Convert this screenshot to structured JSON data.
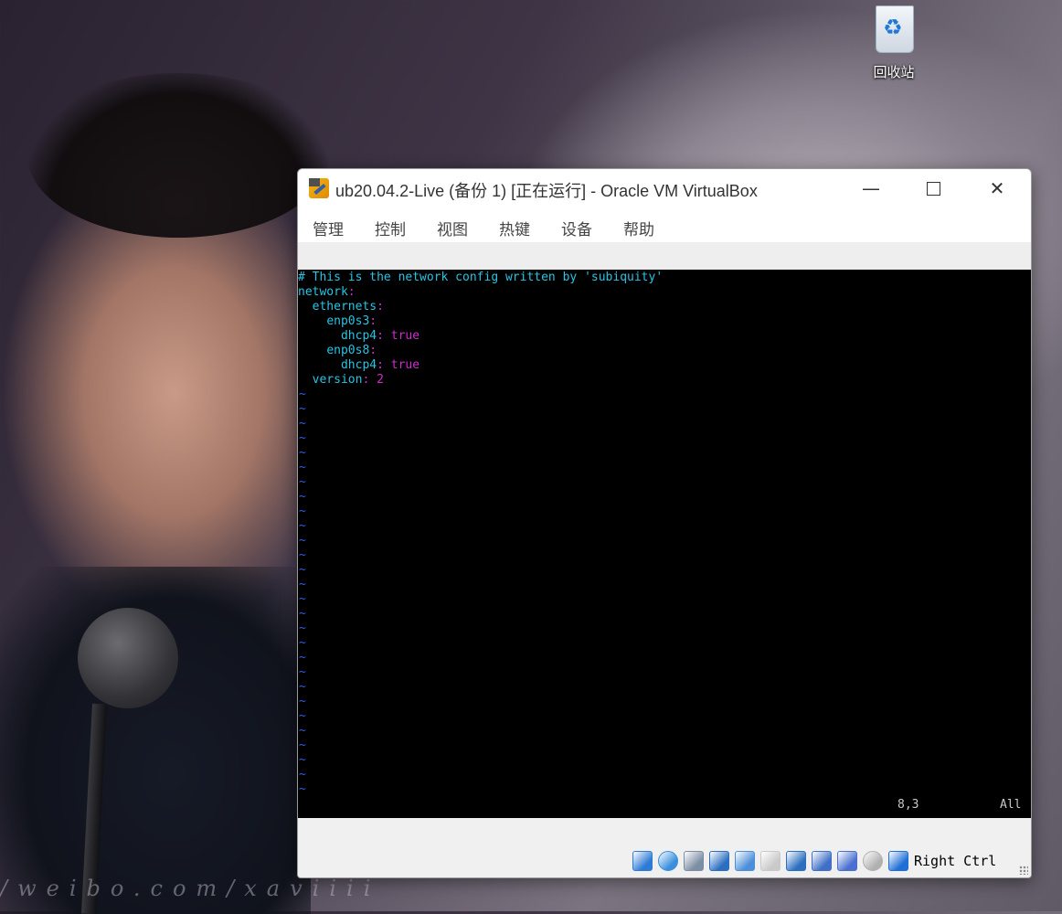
{
  "desktop": {
    "recycle_bin_label": "回收站",
    "watermark": "/weibo.com/xaviiii"
  },
  "window": {
    "title": "ub20.04.2-Live (备份 1) [正在运行] - Oracle VM VirtualBox",
    "min_symbol": "—",
    "close_symbol": "✕"
  },
  "menu": {
    "items": [
      "管理",
      "控制",
      "视图",
      "热键",
      "设备",
      "帮助"
    ]
  },
  "vm": {
    "lines": [
      {
        "indent": "",
        "key": "# This is the network config written by 'subiquity'",
        "colon": "",
        "value": "",
        "kind": "comment"
      },
      {
        "indent": "",
        "key": "network",
        "colon": ":",
        "value": ""
      },
      {
        "indent": "  ",
        "key": "ethernets",
        "colon": ":",
        "value": ""
      },
      {
        "indent": "    ",
        "key": "enp0s3",
        "colon": ":",
        "value": ""
      },
      {
        "indent": "      ",
        "key": "dhcp4",
        "colon": ": ",
        "value": "true"
      },
      {
        "indent": "    ",
        "key": "enp0s8",
        "colon": ":",
        "value": ""
      },
      {
        "indent": "      ",
        "key": "dhcp4",
        "colon": ": ",
        "value": "true"
      },
      {
        "indent": "  ",
        "key": "version",
        "colon": ": ",
        "value": "2"
      }
    ],
    "tilde": "~",
    "tilde_count": 28,
    "cursor_position": "8,3",
    "scroll_indicator": "All"
  },
  "statusbar": {
    "icons": [
      "hard-disk-icon",
      "optical-drive-icon",
      "audio-icon",
      "network-icon",
      "usb-icon",
      "shared-folders-icon",
      "display-icon",
      "video-capture-icon",
      "vt-x-icon",
      "mouse-integration-icon",
      "keyboard-capture-icon"
    ],
    "host_key": "Right Ctrl"
  }
}
